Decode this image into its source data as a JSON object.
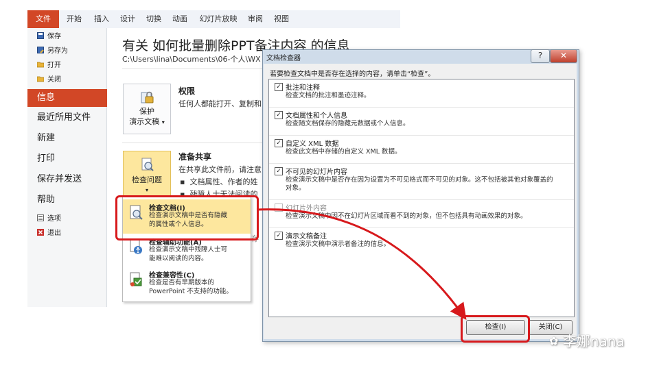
{
  "ribbon_tabs": [
    "文件",
    "开始",
    "插入",
    "设计",
    "切换",
    "动画",
    "幻灯片放映",
    "审阅",
    "视图"
  ],
  "backstage": {
    "small_items": [
      {
        "label": "保存",
        "icon": "save-icon"
      },
      {
        "label": "另存为",
        "icon": "save-as-icon"
      },
      {
        "label": "打开",
        "icon": "open-folder-icon"
      },
      {
        "label": "关闭",
        "icon": "close-file-icon"
      }
    ],
    "nav": [
      "信息",
      "最近所用文件",
      "新建",
      "打印",
      "保存并发送",
      "帮助"
    ],
    "active_nav": "信息",
    "bottom_items": [
      {
        "label": "选项",
        "icon": "options-icon"
      },
      {
        "label": "退出",
        "icon": "exit-icon"
      }
    ]
  },
  "info": {
    "title": "有关 如何批量删除PPT备注内容 的信息",
    "path": "C:\\Users\\lina\\Documents\\06-个人\\WX",
    "permissions": {
      "button_line1": "保护",
      "button_line2": "演示文稿",
      "title": "权限",
      "desc": "任何人都能打开、复制和"
    },
    "prepare": {
      "button_line1": "检查问题",
      "title": "准备共享",
      "desc": "在共享此文件前，请注意",
      "bullet1": "文档属性、作者的姓",
      "bullet2": "残障人士无法阅读的",
      "partial_right": "存"
    }
  },
  "dropdown": [
    {
      "title": "检查文档(I)",
      "desc1": "检查演示文稿中是否有隐藏",
      "desc2": "的属性或个人信息。",
      "icon": "inspect-document-icon",
      "highlighted": true
    },
    {
      "title": "检查辅助功能(A)",
      "desc1": "检查演示文稿中残障人士可",
      "desc2": "能难以阅读的内容。",
      "icon": "accessibility-check-icon",
      "highlighted": false
    },
    {
      "title": "检查兼容性(C)",
      "desc1": "检查是否有早期版本的",
      "desc2": "PowerPoint 不支持的功能。",
      "icon": "compatibility-check-icon",
      "highlighted": false
    }
  ],
  "dialog": {
    "title": "文档检查器",
    "help_label": "?",
    "close_label": "✕",
    "prompt": "若要检查文档中是否存在选择的内容，请单击“检查”。",
    "items": [
      {
        "title": "批注和注释",
        "desc": "检查文档的批注和墨迹注释。",
        "checked": true,
        "enabled": true
      },
      {
        "title": "文档属性和个人信息",
        "desc": "检查随文档保存的隐藏元数据或个人信息。",
        "checked": true,
        "enabled": true
      },
      {
        "title": "自定义 XML 数据",
        "desc": "检查此文档中存储的自定义 XML 数据。",
        "checked": true,
        "enabled": true
      },
      {
        "title": "不可见的幻灯片内容",
        "desc": "检查演示文稿中是否存在因为设置为不可见格式而不可见的对象。这不包括被其他对象覆盖的",
        "desc2": "对象。",
        "checked": true,
        "enabled": true
      },
      {
        "title": "幻灯片外内容",
        "desc": "检查演示文稿中因不在幻灯片区域而看不到的对象，但不包括具有动画效果的对象。",
        "checked": false,
        "enabled": false
      },
      {
        "title": "演示文稿备注",
        "desc": "检查演示文稿中演示者备注的信息。",
        "checked": true,
        "enabled": true
      }
    ],
    "inspect_button": "检查(I)",
    "close_button": "关闭(C)"
  },
  "watermark": "李娜nana",
  "colors": {
    "accent": "#d24726",
    "highlight": "#fde79e",
    "annotation": "#d7191c"
  }
}
